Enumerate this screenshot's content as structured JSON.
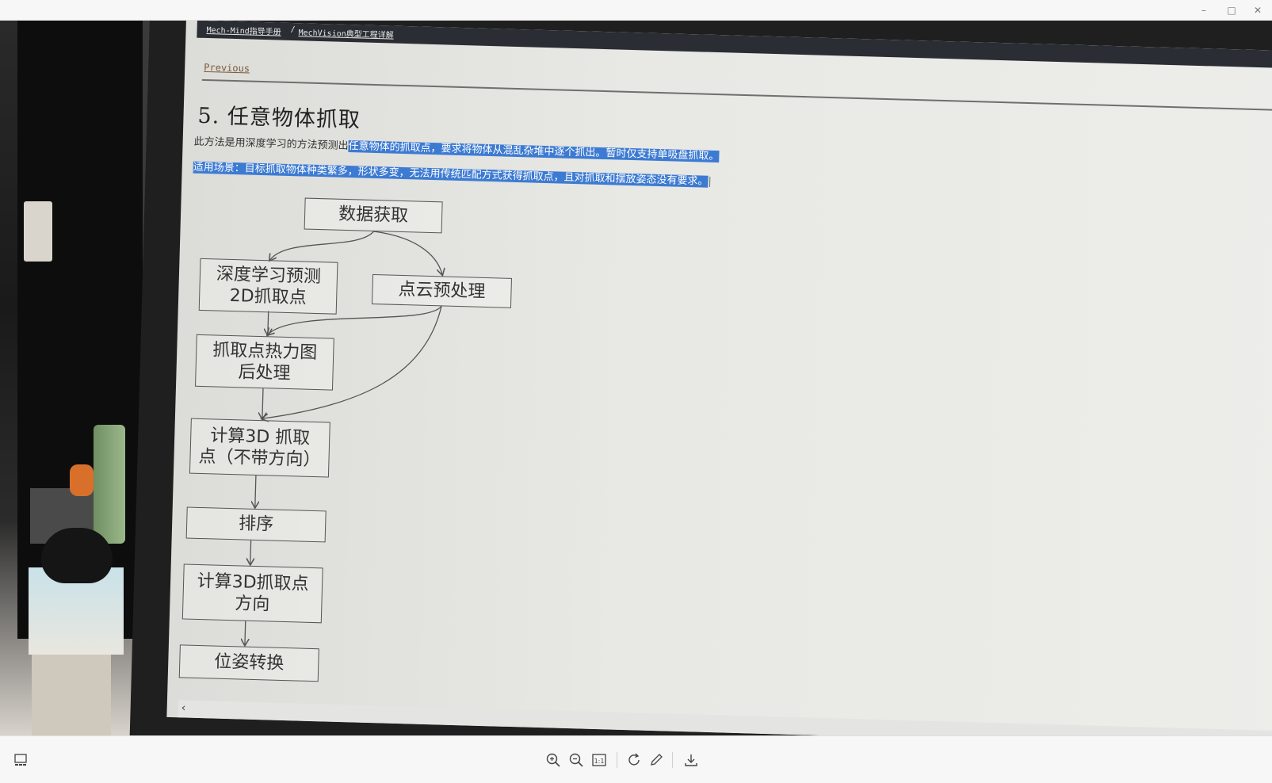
{
  "window": {
    "minimize_glyph": "–",
    "maximize_glyph": "□",
    "close_glyph": "✕"
  },
  "doc": {
    "breadcrumb": [
      "Mech-Mind指导手册",
      "MechVision典型工程详解"
    ],
    "breadcrumb_sep": "/",
    "previous": "Previous",
    "title": "5.  任意物体抓取",
    "para1_plain": "此方法是用深度学习的方法预测出",
    "para1_selected": "任意物体的抓取点，要求将物体从混乱杂堆中逐个抓出。暂时仅支持单吸盘抓取。",
    "para2_selected": "适用场景：目标抓取物体种类繁多，形状多变，无法用传统匹配方式获得抓取点，且对抓取和摆放姿态没有要求。"
  },
  "flowchart": {
    "nodes": {
      "acquire": "数据获取",
      "dl_predict": "深度学习预测\n2D抓取点",
      "pc_preprocess": "点云预处理",
      "heatmap": "抓取点热力图\n后处理",
      "calc3d": "计算3D 抓取\n点（不带方向）",
      "sort": "排序",
      "calc_dir": "计算3D抓取点\n方向",
      "pose": "位姿转换"
    }
  },
  "scroll_left_glyph": "‹",
  "toolbar": {
    "icons": [
      "thumbnail-icon",
      "zoom-in-icon",
      "zoom-out-icon",
      "actual-size-icon",
      "rotate-icon",
      "edit-icon",
      "download-icon"
    ],
    "actual_size_label": "1:1"
  },
  "colors": {
    "selection": "#3d7bd2",
    "breadcrumb_bar": "#2a2d33",
    "toolbar_bg": "#f7f7f7"
  }
}
